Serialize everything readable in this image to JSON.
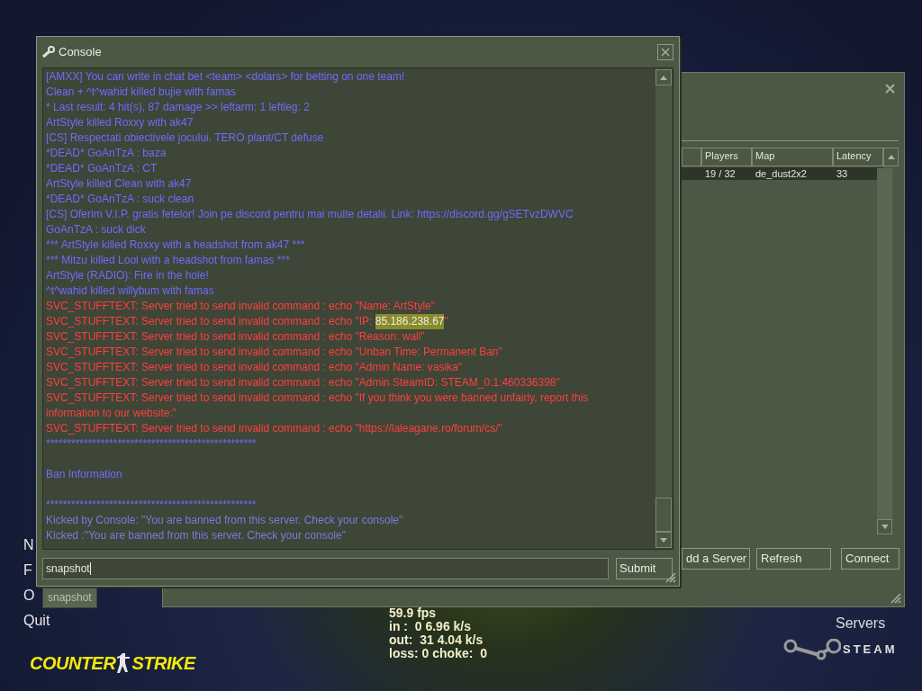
{
  "console": {
    "title": "Console",
    "lines": [
      {
        "kind": "info",
        "text": "[AMXX] You can write in chat bet <team> <dolars> for betting on one team!"
      },
      {
        "kind": "info",
        "text": "Clean + ^t^wahid killed bujie with famas"
      },
      {
        "kind": "info",
        "text": "* Last result: 4 hit(s), 87 damage >> leftarm: 1 leftleg: 2"
      },
      {
        "kind": "info",
        "text": "ArtStyle killed Roxxy with ak47"
      },
      {
        "kind": "info",
        "text": "[CS] Respectati obiectivele jocului. TERO plant/CT defuse"
      },
      {
        "kind": "info",
        "text": "*DEAD* GoAnTzA : baza"
      },
      {
        "kind": "info",
        "text": "*DEAD* GoAnTzA : CT"
      },
      {
        "kind": "info",
        "text": "ArtStyle killed Clean with ak47"
      },
      {
        "kind": "info",
        "text": "*DEAD* GoAnTzA : suck clean"
      },
      {
        "kind": "info",
        "text": "[CS] Oferim V.I.P. gratis fetelor! Join pe discord pentru mai multe detalii. Link: https://discord.gg/gSETvzDWVC"
      },
      {
        "kind": "info",
        "text": "GoAnTzA : suck dick"
      },
      {
        "kind": "info",
        "text": "*** ArtStyle killed Roxxy with a headshot from ak47 ***"
      },
      {
        "kind": "info",
        "text": "*** Mitzu killed Lool with a headshot from famas ***"
      },
      {
        "kind": "info",
        "text": "ArtStyle (RADIO): Fire in the hole!"
      },
      {
        "kind": "info",
        "text": "^t^wahid killed willybum with famas"
      },
      {
        "kind": "error",
        "text": "SVC_STUFFTEXT: Server tried to send invalid command : echo \"Name: ArtStyle\""
      },
      {
        "kind": "error",
        "segments": [
          {
            "text": "SVC_STUFFTEXT: Server tried to send invalid command : echo \"IP: ",
            "selected": false
          },
          {
            "text": "85.186.238.67",
            "selected": true
          },
          {
            "text": "\"",
            "selected": false
          }
        ]
      },
      {
        "kind": "error",
        "text": "SVC_STUFFTEXT: Server tried to send invalid command : echo \"Reason: wall\""
      },
      {
        "kind": "error",
        "text": "SVC_STUFFTEXT: Server tried to send invalid command : echo \"Unban Time: Permanent Ban\""
      },
      {
        "kind": "error",
        "text": "SVC_STUFFTEXT: Server tried to send invalid command : echo \"Admin Name: vasika\""
      },
      {
        "kind": "error",
        "text": "SVC_STUFFTEXT: Server tried to send invalid command : echo \"Admin SteamID: STEAM_0:1:460336398\""
      },
      {
        "kind": "error",
        "text": "SVC_STUFFTEXT: Server tried to send invalid command : echo \"If you think you were banned unfairly, report this information to our website:\""
      },
      {
        "kind": "error",
        "text": "SVC_STUFFTEXT: Server tried to send invalid command : echo \"https://laleagane.ro/forum/cs/\""
      },
      {
        "kind": "info",
        "text": "**************************************************"
      },
      {
        "kind": "blank"
      },
      {
        "kind": "info",
        "text": "Ban Information"
      },
      {
        "kind": "blank"
      },
      {
        "kind": "info",
        "text": "**************************************************"
      },
      {
        "kind": "kick",
        "text": "Kicked by Console: \"You are banned from this server. Check your console\""
      },
      {
        "kind": "kick",
        "text": "Kicked :\"You are banned from this server. Check your console\""
      }
    ],
    "input": {
      "value": "snapshot"
    },
    "submit": "Submit",
    "autocomplete": [
      "snapshot"
    ]
  },
  "server_browser": {
    "columns": [
      "Players",
      "Map",
      "Latency"
    ],
    "rows": [
      {
        "cells": [
          "19 / 32",
          "de_dust2x2",
          "33"
        ],
        "selected": true
      }
    ],
    "buttons": [
      "dd a Server",
      "Refresh",
      "Connect"
    ]
  },
  "main_menu": {
    "items": [
      "N",
      "F",
      "O",
      "Quit"
    ],
    "logo": {
      "word_1": "COUNTER",
      "word_2": "STRIKE"
    }
  },
  "net_graph": [
    "59.9 fps",
    "in :  0 6.96 k/s",
    "out:  31 4.04 k/s",
    "loss: 0 choke:  0"
  ],
  "servers_label": "Servers",
  "steam": "STEAM"
}
